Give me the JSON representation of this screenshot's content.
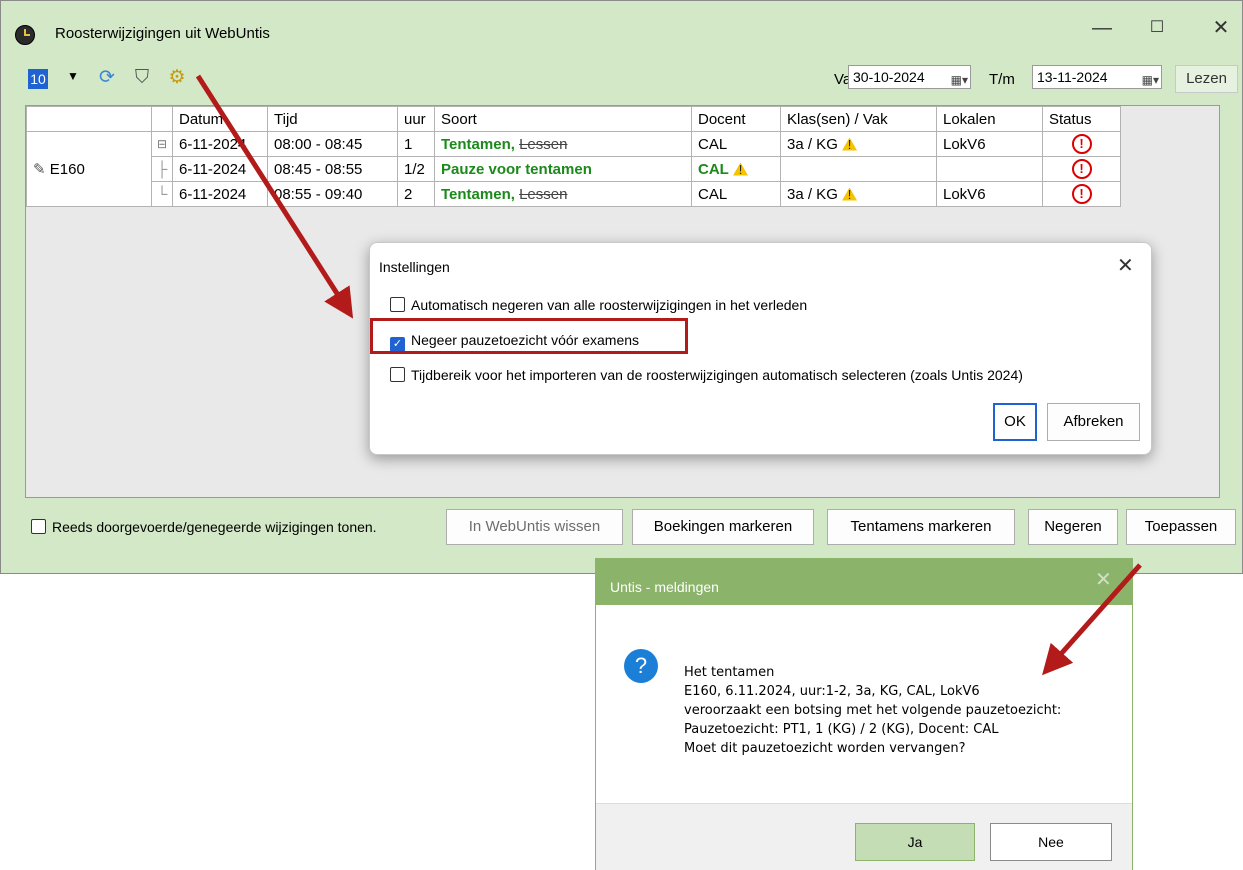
{
  "window": {
    "title": "Roosterwijzigingen uit WebUntis",
    "minimize": "—",
    "maximize": "☐",
    "close": "✕"
  },
  "toolbar": {
    "week_value": "10",
    "lbl_van": "Van",
    "date_van": "30-10-2024",
    "lbl_tm": "T/m",
    "date_tm": "13-11-2024",
    "lezen": "Lezen"
  },
  "grid": {
    "headers": [
      "Datum",
      "Tijd",
      "uur",
      "Soort",
      "Docent",
      "Klas(sen) / Vak",
      "Lokalen",
      "Status"
    ],
    "group_label": "E160",
    "rows": [
      {
        "datum": "6-11-2024",
        "tijd": "08:00 - 08:45",
        "uur": "1",
        "soort_main": "Tentamen",
        "soort_strike": "Lessen",
        "docent": "CAL",
        "klas": "3a / KG",
        "lokaal": "LokV6",
        "status": "!"
      },
      {
        "datum": "6-11-2024",
        "tijd": "08:45 - 08:55",
        "uur": "1/2",
        "soort_main": "Pauze voor tentamen",
        "soort_strike": "",
        "docent": "CAL",
        "klas": "",
        "lokaal": "",
        "status": "!"
      },
      {
        "datum": "6-11-2024",
        "tijd": "08:55 - 09:40",
        "uur": "2",
        "soort_main": "Tentamen",
        "soort_strike": "Lessen",
        "docent": "CAL",
        "klas": "3a / KG",
        "lokaal": "LokV6",
        "status": "!"
      }
    ]
  },
  "bottom": {
    "show_done": "Reeds doorgevoerde/genegeerde wijzigingen tonen.",
    "buttons": [
      "In WebUntis wissen",
      "Boekingen markeren",
      "Tentamens markeren",
      "Negeren",
      "Toepassen"
    ]
  },
  "settings": {
    "title": "Instellingen",
    "options": [
      {
        "label": "Automatisch negeren van alle roosterwijzigingen in het verleden",
        "checked": false
      },
      {
        "label": "Negeer pauzetoezicht vóór examens",
        "checked": true
      },
      {
        "label": "Tijdbereik voor het importeren van de roosterwijzigingen automatisch selecteren (zoals Untis 2024)",
        "checked": false
      }
    ],
    "ok": "OK",
    "cancel": "Afbreken"
  },
  "message": {
    "title": "Untis - meldingen",
    "lines": [
      "Het tentamen",
      "E160,  6.11.2024, uur:1-2, 3a, KG, CAL, LokV6",
      "veroorzaakt een botsing met het volgende pauzetoezicht:",
      "Pauzetoezicht: PT1, 1 (KG) / 2 (KG), Docent: CAL",
      "Moet dit pauzetoezicht worden vervangen?"
    ],
    "yes": "Ja",
    "no": "Nee"
  },
  "colors": {
    "window_bg": "#d2e8c6",
    "accent_green": "#8bb46a",
    "arrow_red": "#b31a1a",
    "status_red": "#d00000",
    "text_green": "#1b8a1b"
  }
}
